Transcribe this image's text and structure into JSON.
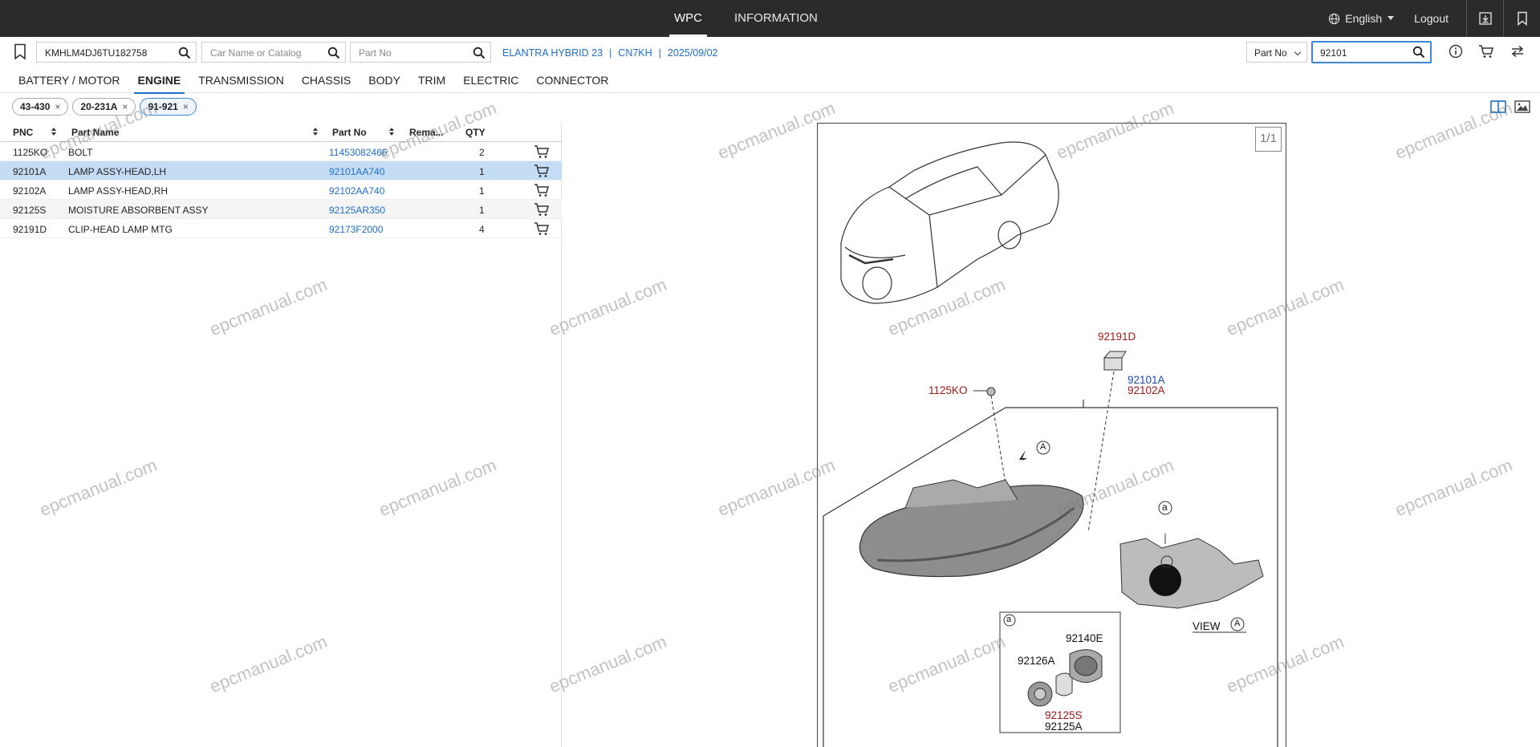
{
  "topbar": {
    "nav": [
      {
        "label": "WPC",
        "active": true
      },
      {
        "label": "INFORMATION",
        "active": false
      }
    ],
    "language": "English",
    "logout": "Logout"
  },
  "search": {
    "vin_value": "KMHLM4DJ6TU182758",
    "car_name_placeholder": "Car Name or Catalog",
    "part_no_placeholder": "Part No",
    "vehicle_info": [
      "ELANTRA HYBRID 23",
      "CN7KH",
      "2025/09/02"
    ],
    "search_type": "Part No",
    "search_value": "92101"
  },
  "categories": [
    {
      "label": "BATTERY / MOTOR",
      "active": false
    },
    {
      "label": "ENGINE",
      "active": true
    },
    {
      "label": "TRANSMISSION",
      "active": false
    },
    {
      "label": "CHASSIS",
      "active": false
    },
    {
      "label": "BODY",
      "active": false
    },
    {
      "label": "TRIM",
      "active": false
    },
    {
      "label": "ELECTRIC",
      "active": false
    },
    {
      "label": "CONNECTOR",
      "active": false
    }
  ],
  "chips": [
    {
      "label": "43-430",
      "active": false
    },
    {
      "label": "20-231A",
      "active": false
    },
    {
      "label": "91-921",
      "active": true
    }
  ],
  "table": {
    "headers": [
      "PNC",
      "Part Name",
      "Part No",
      "Rema...",
      "QTY"
    ],
    "rows": [
      {
        "pnc": "1125KO",
        "name": "BOLT",
        "part_no": "11453082466",
        "remark": "",
        "qty": "2",
        "state": "normal"
      },
      {
        "pnc": "92101A",
        "name": "LAMP ASSY-HEAD,LH",
        "part_no": "92101AA740",
        "remark": "",
        "qty": "1",
        "state": "selected"
      },
      {
        "pnc": "92102A",
        "name": "LAMP ASSY-HEAD,RH",
        "part_no": "92102AA740",
        "remark": "",
        "qty": "1",
        "state": "normal"
      },
      {
        "pnc": "92125S",
        "name": "MOISTURE ABSORBENT ASSY",
        "part_no": "92125AR350",
        "remark": "",
        "qty": "1",
        "state": "alt"
      },
      {
        "pnc": "92191D",
        "name": "CLIP-HEAD LAMP MTG",
        "part_no": "92173F2000",
        "remark": "",
        "qty": "4",
        "state": "normal"
      }
    ]
  },
  "diagram": {
    "page": "1/1",
    "labels": {
      "clip": "92191D",
      "lamp_lh": "92101A",
      "lamp_rh": "92102A",
      "bolt": "1125KO",
      "view_arrow": "A",
      "detail_marker": "a",
      "view_label": "VIEW",
      "view_circle": "A",
      "inset_marker": "a",
      "cap": "92140E",
      "part_a": "92126A",
      "part_s": "92125S",
      "part_a2": "92125A"
    }
  },
  "watermark": "epcmanual.com",
  "colors": {
    "topbar": "#2b2b2b",
    "accent": "#1e6ec8",
    "selected_row": "#c5dcf5",
    "label_red": "#a01818",
    "label_blue": "#1a4fb0"
  }
}
